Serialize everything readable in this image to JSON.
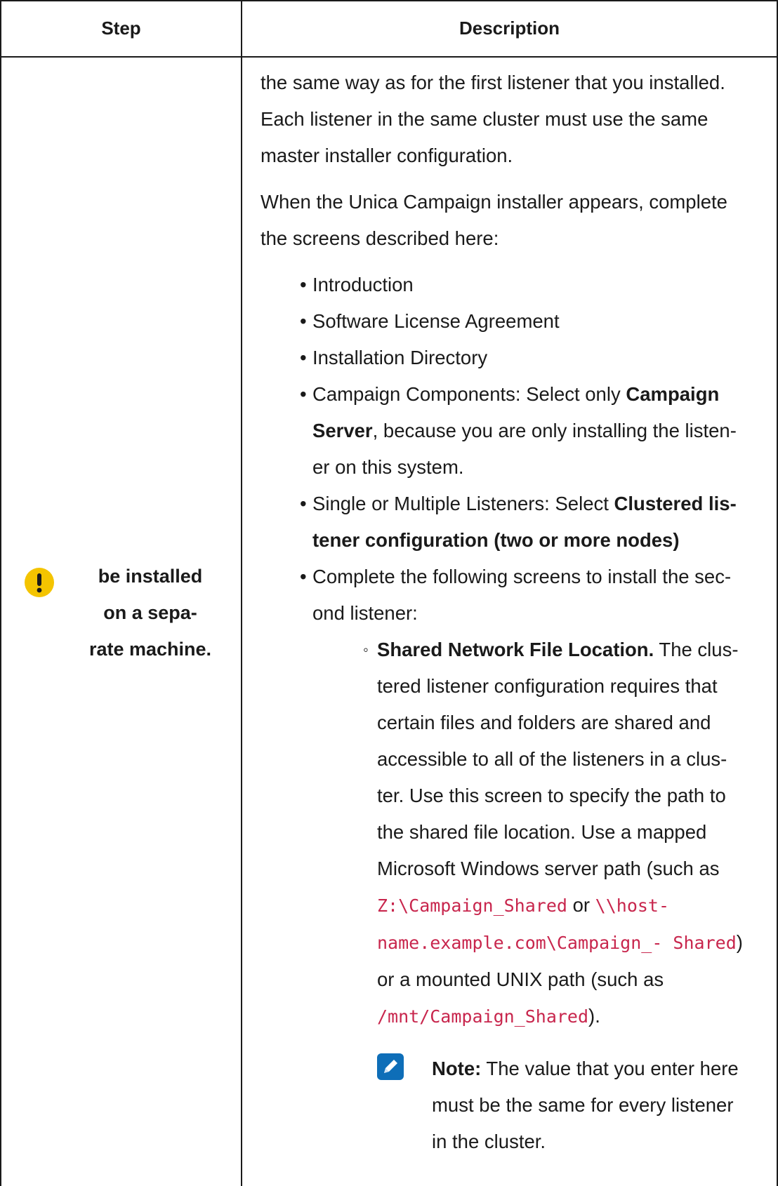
{
  "header": {
    "step": "Step",
    "description": "Description"
  },
  "step_cell": {
    "text_lines": [
      "be installed",
      "on a sepa-",
      "rate machine."
    ],
    "icon": "warning-icon"
  },
  "description": {
    "para1": "the same way as for the first listener that you installed. Each listener in the same cluster must use the same master installer configuration.",
    "para2": "When the Unica Campaign installer appears, complete the screens described here:",
    "items": {
      "intro": "Introduction",
      "license": "Software License Agreement",
      "dir": "Installation Directory",
      "components_pre": "Campaign Components: Select only ",
      "components_bold": "Campaign Server",
      "components_post": ", because you are only installing the listen- er on this system.",
      "listeners_pre": "Single or Multiple Listeners: Select ",
      "listeners_bold": "Clustered lis- tener configuration (two or more nodes)",
      "complete": "Complete the following screens to install the sec- ond listener:"
    },
    "subitem": {
      "bold": "Shared Network File Location.",
      "text1": " The clus- tered listener configuration requires that certain files and folders are shared and accessible to all of the listeners in a clus- ter. Use this screen to specify the path to the shared file location. Use a mapped Microsoft Windows server path (such as ",
      "code1": "Z:\\Campaign_Shared",
      "or": " or ",
      "code2": "\\\\host- name.example.com\\Campaign_- Shared",
      "text2": ") or a mounted UNIX path (such as ",
      "code3": "/mnt/Campaign_Shared",
      "text3": ")."
    },
    "note": {
      "label": "Note:",
      "text": " The value that you enter here must be the same for every listener in the cluster.",
      "icon": "pencil-icon"
    }
  },
  "colors": {
    "warning": "#f4c400",
    "note": "#0e6eb8",
    "code": "#c8264d",
    "border": "#1a1a1a"
  }
}
